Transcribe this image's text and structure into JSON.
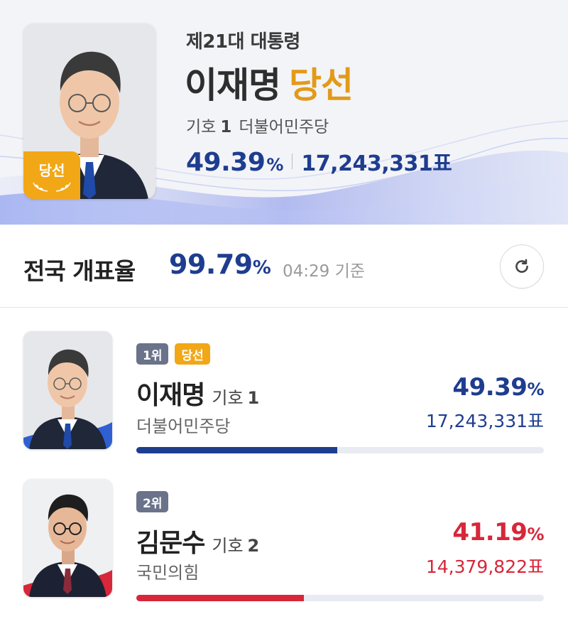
{
  "hero": {
    "subtitle": "제21대 대통령",
    "name": "이재명",
    "result": "당선",
    "number_label": "기호",
    "number": "1",
    "party": "더불어민주당",
    "percent": "49.39",
    "percent_unit": "%",
    "votes": "17,243,331표",
    "photo_badge": "당선"
  },
  "count": {
    "label": "전국 개표율",
    "percent": "99.79",
    "percent_unit": "%",
    "time": "04:29 기준",
    "refresh_icon": "refresh-icon"
  },
  "candidates": [
    {
      "rank": "1위",
      "badge": "당선",
      "name": "이재명",
      "number_label": "기호",
      "number": "1",
      "party": "더불어민주당",
      "percent": "49.39",
      "percent_unit": "%",
      "votes": "17,243,331표",
      "share": 49.39,
      "color": "#1e3d8f"
    },
    {
      "rank": "2위",
      "name": "김문수",
      "number_label": "기호",
      "number": "2",
      "party": "국민의힘",
      "percent": "41.19",
      "percent_unit": "%",
      "votes": "14,379,822표",
      "share": 41.19,
      "color": "#d8263a"
    }
  ],
  "colors": {
    "accent_blue": "#1e3d8f",
    "accent_red": "#d8263a",
    "winner_gold": "#f2a716"
  }
}
